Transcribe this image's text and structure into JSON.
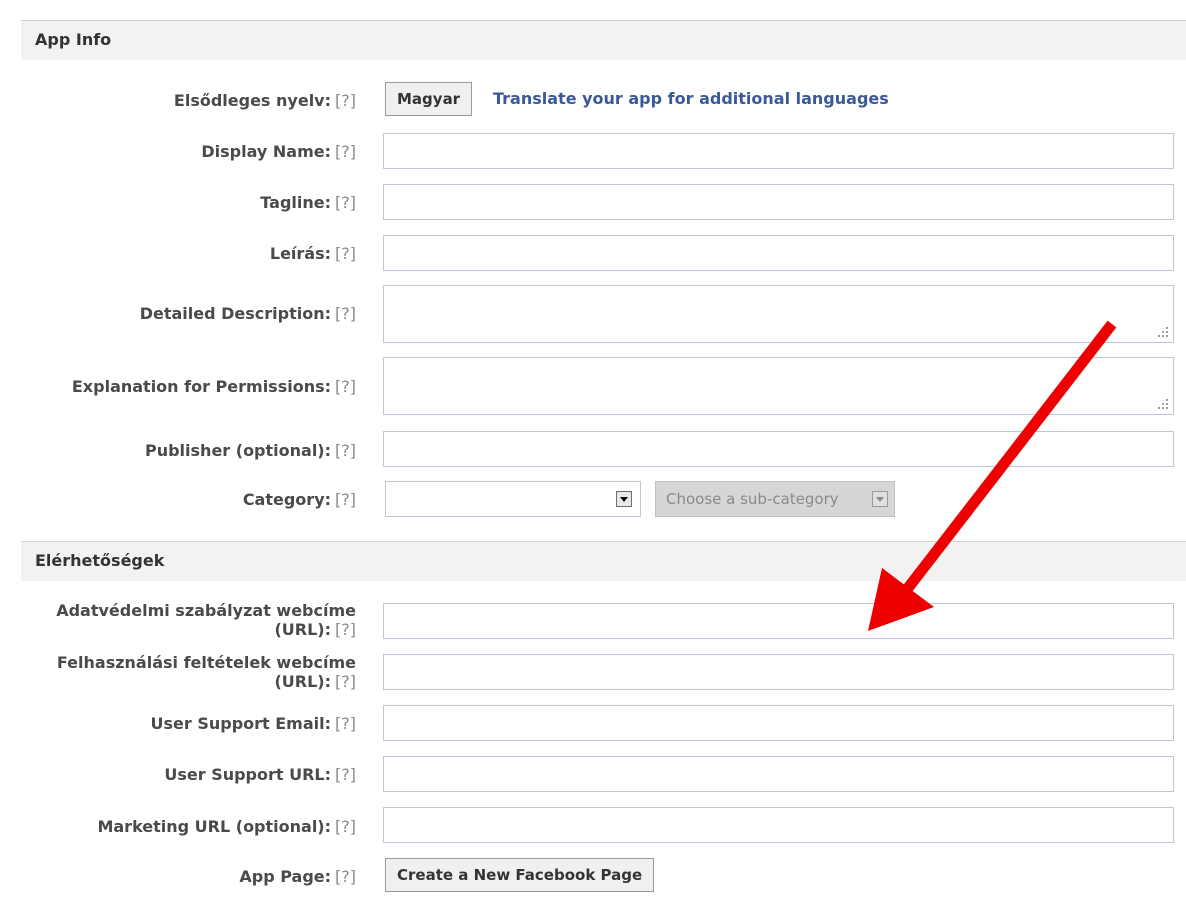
{
  "sections": {
    "app_info": "App Info",
    "contact": "Elérhetőségek"
  },
  "help_marker": "[?]",
  "app_info": {
    "primary_language": {
      "label": "Elsődleges nyelv:",
      "button": "Magyar",
      "link": "Translate your app for additional languages"
    },
    "display_name": {
      "label": "Display Name:",
      "value": ""
    },
    "tagline": {
      "label": "Tagline:",
      "value": ""
    },
    "description": {
      "label": "Leírás:",
      "value": ""
    },
    "detailed_description": {
      "label": "Detailed Description:",
      "value": ""
    },
    "permissions_explanation": {
      "label": "Explanation for Permissions:",
      "value": ""
    },
    "publisher": {
      "label": "Publisher (optional):",
      "value": ""
    },
    "category": {
      "label": "Category:",
      "value": "",
      "subcategory_placeholder": "Choose a sub-category"
    }
  },
  "contact": {
    "privacy_url": {
      "label_line1": "Adatvédelmi szabályzat webcíme",
      "label_line2": "(URL):",
      "value": ""
    },
    "terms_url": {
      "label_line1": "Felhasználási feltételek webcíme",
      "label_line2": "(URL):",
      "value": ""
    },
    "support_email": {
      "label": "User Support Email:",
      "value": ""
    },
    "support_url": {
      "label": "User Support URL:",
      "value": ""
    },
    "marketing_url": {
      "label": "Marketing URL (optional):",
      "value": ""
    },
    "app_page": {
      "label": "App Page:",
      "button": "Create a New Facebook Page"
    }
  },
  "colors": {
    "link": "#3b5998",
    "arrow": "#ee0000",
    "header_bg": "#f2f2f2",
    "input_border": "#bdc7d8"
  },
  "annotation": {
    "icon": "red-arrow-icon"
  }
}
